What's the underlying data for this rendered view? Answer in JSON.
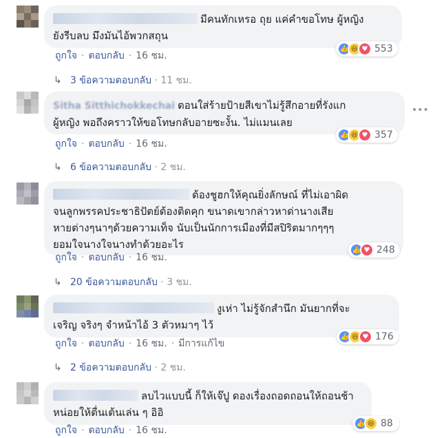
{
  "comments": [
    {
      "id": "c1",
      "name": "",
      "lines": [
        "มีคนทักเหรอ ถุย แค่คำขอโทษ ผู้หญิง",
        "ยังรีบลบ มึงมันไอ้พวกสถุน"
      ],
      "reactions": [
        "like",
        "haha",
        "love"
      ],
      "reaction_count": "553",
      "actions": [
        "ถูกใจ",
        "ตอบกลับ",
        "16 ชม."
      ],
      "replies_label": "3 ข้อความตอบกลับ",
      "replies_time": "11 ชม.",
      "avatar_colors": [
        "#8a7d6e",
        "#9b8e80",
        "#6d655c",
        "#b0a090",
        "#7a6e60",
        "#a89888",
        "#5c544c",
        "#8c7f70",
        "#6b6158"
      ]
    },
    {
      "id": "c2",
      "name": "Sitha Sitthichokkechai",
      "lines": [
        "ตอนใส่ร้ายป้ายสีเขาไม่รู้สึกอายที่รังแก",
        "ผู้หญิง พอถึงคราวให้ขอโทษกลับอายซะงั้น. ไม่แมนเลย"
      ],
      "reactions": [
        "like",
        "haha",
        "love"
      ],
      "reaction_count": "357",
      "actions": [
        "ถูกใจ",
        "ตอบกลับ",
        "16 ชม."
      ],
      "replies_label": "6 ข้อความตอบกลับ",
      "replies_time": "2 ชม.",
      "avatar_colors": [
        "#c8c8c8",
        "#dcdcdc",
        "#b8b8b8",
        "#d4d4d4",
        "#a8a8a8",
        "#c4c4c4",
        "#e0e0e0",
        "#b4b4b4",
        "#cccccc"
      ]
    },
    {
      "id": "c3",
      "name": "",
      "lines": [
        "ต้องชูฮกให้คุณยิ่งลักษณ์ ที่ไม่เอาผิด",
        "จนลูกพรรคประชาธิปัตย์ต้องติดคุก ขนาดเขากล่าวหาด่านางเสีย",
        "หายต่างๆนาๆด้วยความเท็จ นับเป็นนักการเมืองที่มีสปิริตมากๆๆๆ",
        "ยอมใจนางใจนางทำด้วยอะไร"
      ],
      "reactions": [
        "like",
        "love"
      ],
      "reaction_count": "248",
      "actions": [
        "ถูกใจ",
        "ตอบกลับ",
        "16 ชม."
      ],
      "replies_label": "20 ข้อความตอบกลับ",
      "replies_time": "3 ชม.",
      "avatar_colors": [
        "#9a9aa6",
        "#b4b4bc",
        "#8c8c98",
        "#aaaab4",
        "#c0c0c8",
        "#9e9eaa",
        "#b8b8c0",
        "#a4a4ae",
        "#92929e"
      ]
    },
    {
      "id": "c4",
      "name": "",
      "lines": [
        "งูเห่า ไม่รู้จักสำนึก มันยากที่จะ",
        "เจริญ จริงๆ จำหน้าไอ้ 3 ตัวหมาๆ ไว้"
      ],
      "reactions": [
        "like",
        "haha",
        "love"
      ],
      "reaction_count": "176",
      "actions": [
        "ถูกใจ",
        "ตอบกลับ",
        "16 ชม.",
        "มีการแก้ไข"
      ],
      "replies_label": "2 ข้อความตอบกลับ",
      "replies_time": "2 ชม.",
      "avatar_colors": [
        "#6e7a5c",
        "#8a9470",
        "#5c6650",
        "#7c8a68",
        "#9aa080",
        "#6a7458",
        "#8090a0",
        "#7080b0",
        "#606c90"
      ]
    },
    {
      "id": "c5",
      "name": "",
      "lines": [
        "ลบไวแบบนี้ ก็ให้เจ๊ปู ดองเรื่องถอดถอนให้ถอนช้า",
        "หน่อยให้ตื่นเต้นเล่น ๆ อิอิ"
      ],
      "reactions": [
        "like",
        "haha"
      ],
      "reaction_count": "88",
      "actions": [
        "ถูกใจ",
        "ตอบกลับ",
        "16 ชม."
      ],
      "replies_label": "",
      "replies_time": "",
      "avatar_colors": [
        "#bdbdbd",
        "#cfcfcf",
        "#b0b0b0",
        "#c6c6c6",
        "#d8d8d8",
        "#bababa",
        "#cacaca",
        "#b6b6b6",
        "#d0d0d0"
      ]
    }
  ],
  "more_options_icon": "ellipsis-icon",
  "reply_arrow_icon": "reply-arrow-icon",
  "colors": {
    "link": "#385898",
    "muted": "#606770",
    "bubble": "#f2f3f5",
    "like": "#5890ff",
    "love": "#f25268",
    "haha": "#f7d046"
  }
}
